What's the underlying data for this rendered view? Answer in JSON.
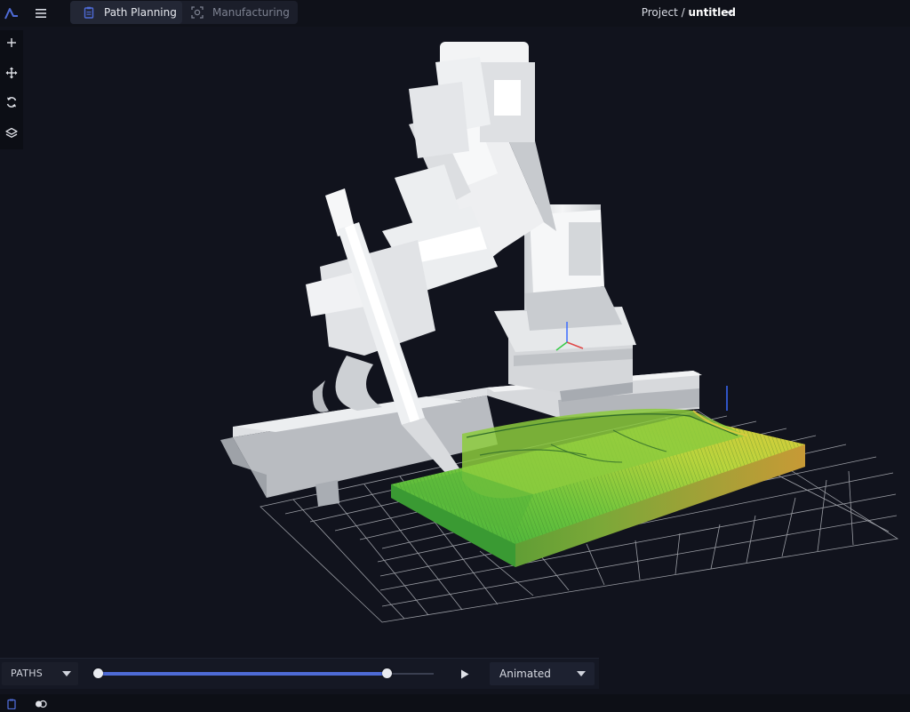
{
  "header": {
    "tabs": [
      {
        "label": "Path Planning",
        "icon": "clipboard-icon",
        "active": true
      },
      {
        "label": "Manufacturing",
        "icon": "robot-cell-icon",
        "active": false
      }
    ],
    "project": {
      "prefix": "Project /",
      "name": "untitled"
    }
  },
  "toolbar": {
    "tools": [
      "add-icon",
      "move-icon",
      "rotate-icon",
      "layers-icon"
    ]
  },
  "controls": {
    "paths_label": "PATHS",
    "playback_mode": "Animated",
    "range_start": 0.0,
    "range_end": 0.86
  },
  "statusbar": {
    "icons": [
      "clipboard-icon",
      "toggle-icon"
    ]
  },
  "colors": {
    "accent": "#4e6bd6",
    "background": "#11131d",
    "toolpath_green": "#6cc43c",
    "toolpath_yellow": "#d8d23a"
  }
}
